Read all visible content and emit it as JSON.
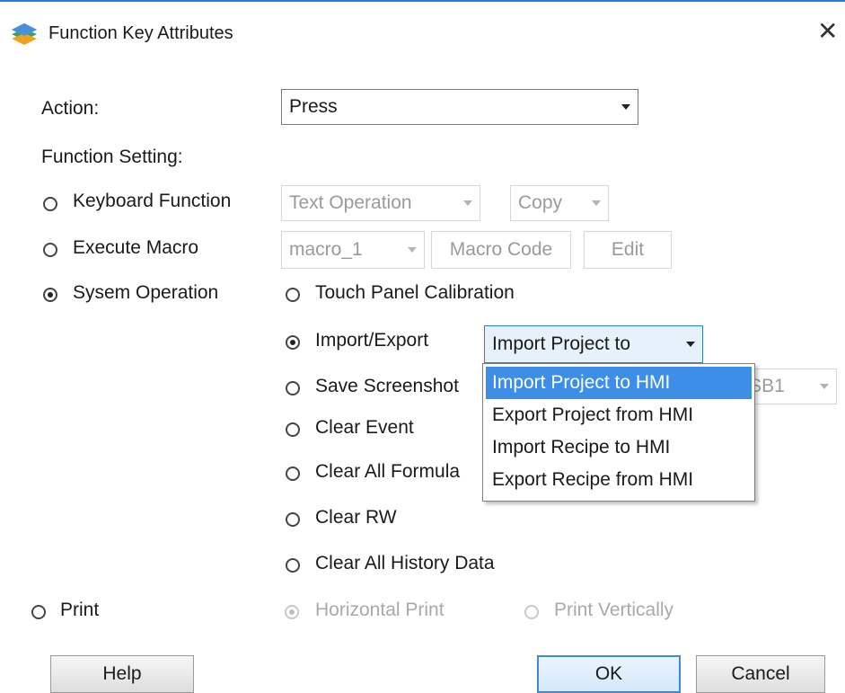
{
  "window": {
    "title": "Function Key Attributes",
    "close_glyph": "✕",
    "icon": "app-layers-icon"
  },
  "action": {
    "label": "Action:",
    "value": "Press"
  },
  "function_setting": {
    "label": "Function Setting:"
  },
  "keyboard_function": {
    "label": "Keyboard Function",
    "selected": false,
    "op_value": "Text Operation",
    "sub_value": "Copy"
  },
  "execute_macro": {
    "label": "Execute Macro",
    "selected": false,
    "macro_value": "macro_1",
    "macro_code_label": "Macro Code",
    "edit_label": "Edit"
  },
  "system_operation": {
    "label": "Sysem Operation",
    "selected": true,
    "options": {
      "touch_calibration": {
        "label": "Touch Panel Calibration",
        "selected": false
      },
      "import_export": {
        "label": "Import/Export",
        "selected": true,
        "value": "Import Project to"
      },
      "save_screenshot": {
        "label": "Save Screenshot",
        "selected": false,
        "target_value": "USB1"
      },
      "clear_event": {
        "label": "Clear Event",
        "selected": false
      },
      "clear_formula": {
        "label": "Clear All Formula",
        "selected": false
      },
      "clear_rw": {
        "label": "Clear RW",
        "selected": false
      },
      "clear_history": {
        "label": "Clear All History Data",
        "selected": false
      }
    }
  },
  "dropdown": {
    "items": [
      "Import Project to HMI",
      "Export Project from HMI",
      "Import Recipe to HMI",
      "Export Recipe from HMI"
    ],
    "highlighted_index": 0
  },
  "print": {
    "label": "Print",
    "selected": false,
    "horizontal_label": "Horizontal Print",
    "vertical_label": "Print Vertically",
    "horizontal_selected": true
  },
  "buttons": {
    "help": "Help",
    "ok": "OK",
    "cancel": "Cancel"
  },
  "colors": {
    "accent": "#3d8ee6",
    "topline": "#2b79d8",
    "disabled_text": "#a9a9a9"
  }
}
